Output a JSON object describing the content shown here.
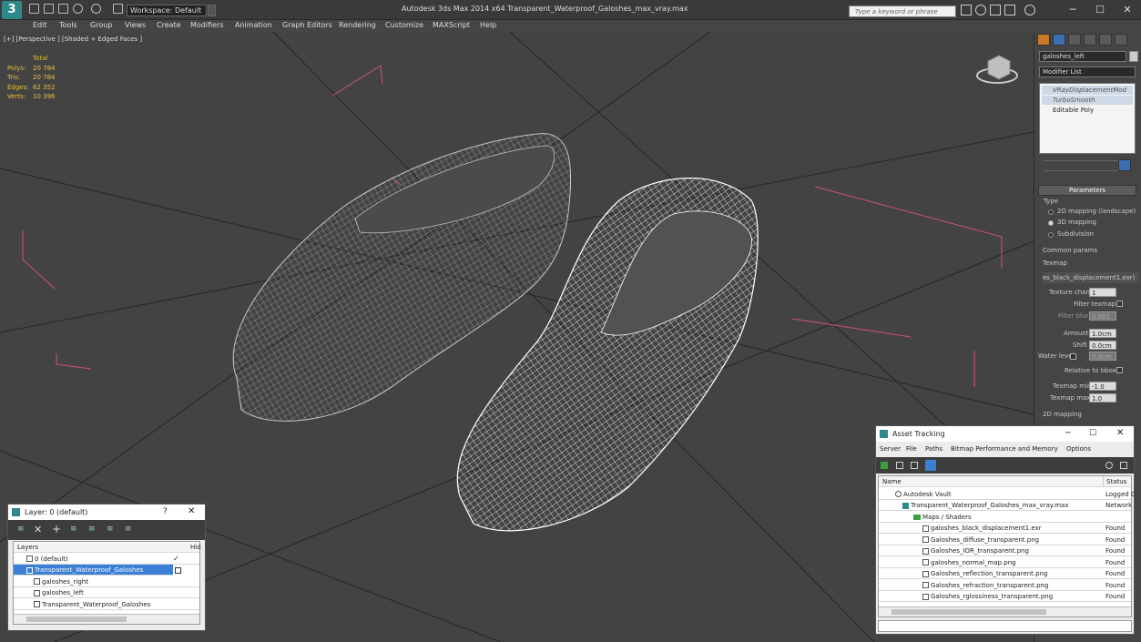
{
  "titlebar": {
    "logo": "3",
    "workspace": "Workspace: Default",
    "title": "Autodesk 3ds Max  2014 x64     Transparent_Waterproof_Galoshes_max_vray.max",
    "search_placeholder": "Type a keyword or phrase",
    "minimize": "─",
    "maximize": "☐",
    "close": "✕"
  },
  "menus": [
    "Edit",
    "Tools",
    "Group",
    "Views",
    "Create",
    "Modifiers",
    "Animation",
    "Graph Editors",
    "Rendering",
    "Customize",
    "MAXScript",
    "Help"
  ],
  "viewport": {
    "label": "[+] [Perspective ] [Shaded + Edged Faces ]",
    "stats": {
      "header": "Total",
      "polys_label": "Polys:",
      "polys": "20 784",
      "tris_label": "Tris:",
      "tris": "20 784",
      "edges_label": "Edges:",
      "edges": "62 352",
      "verts_label": "Verts:",
      "verts": "10 396"
    }
  },
  "command_panel": {
    "object_name": "galoshes_left",
    "modifier_list": "Modifier List",
    "stack": [
      "VRayDisplacementMod",
      "TurboSmooth",
      "Editable Poly"
    ],
    "parameters_title": "Parameters",
    "type_label": "Type",
    "type_options": [
      "2D mapping (landscape)",
      "3D mapping",
      "Subdivision"
    ],
    "type_selected": 1,
    "common_params": "Common params",
    "texmap_label": "Texmap",
    "texmap_value": "es_black_displacement1.exr)",
    "texture_chan_label": "Texture chan",
    "texture_chan": "1",
    "filter_texmap": "Filter texmap",
    "filter_blur_label": "Filter blur",
    "filter_blur": "0.001",
    "amount_label": "Amount",
    "amount": "1.0cm",
    "shift_label": "Shift",
    "shift": "0.0cm",
    "water_level_label": "Water level",
    "water_level": "0.0cm",
    "relative_bbox": "Relative to bbox",
    "texmap_min_label": "Texmap min",
    "texmap_min": "-1.0",
    "texmap_max_label": "Texmap max",
    "texmap_max": "1.0",
    "mapping_2d": "2D mapping"
  },
  "layer_window": {
    "title": "Layer: 0 (default)",
    "help": "?",
    "close": "✕",
    "col_layers": "Layers",
    "col_hide": "Hid",
    "rows": [
      "0 (default)",
      "Transparent_Waterproof_Galoshes",
      "galoshes_right",
      "galoshes_left",
      "Transparent_Waterproof_Galoshes"
    ],
    "check": "✓"
  },
  "asset_window": {
    "title": "Asset Tracking",
    "minimize": "─",
    "maximize": "☐",
    "close": "✕",
    "menus": [
      "Server",
      "File",
      "Paths",
      "Bitmap Performance and Memory",
      "Options"
    ],
    "col_name": "Name",
    "col_status": "Status",
    "rows": [
      {
        "name": "Autodesk Vault",
        "status": "Logged C",
        "indent": 0
      },
      {
        "name": "Transparent_Waterproof_Galoshes_max_vray.max",
        "status": "Network",
        "indent": 1
      },
      {
        "name": "Maps / Shaders",
        "status": "",
        "indent": 2
      },
      {
        "name": "galoshes_black_displacement1.exr",
        "status": "Found",
        "indent": 3
      },
      {
        "name": "Galoshes_diffuse_transparent.png",
        "status": "Found",
        "indent": 3
      },
      {
        "name": "Galoshes_IOR_transparent.png",
        "status": "Found",
        "indent": 3
      },
      {
        "name": "galoshes_normal_map.png",
        "status": "Found",
        "indent": 3
      },
      {
        "name": "Galoshes_reflection_transparent.png",
        "status": "Found",
        "indent": 3
      },
      {
        "name": "Galoshes_refraction_transparent.png",
        "status": "Found",
        "indent": 3
      },
      {
        "name": "Galoshes_rglossiness_transparent.png",
        "status": "Found",
        "indent": 3
      }
    ]
  }
}
